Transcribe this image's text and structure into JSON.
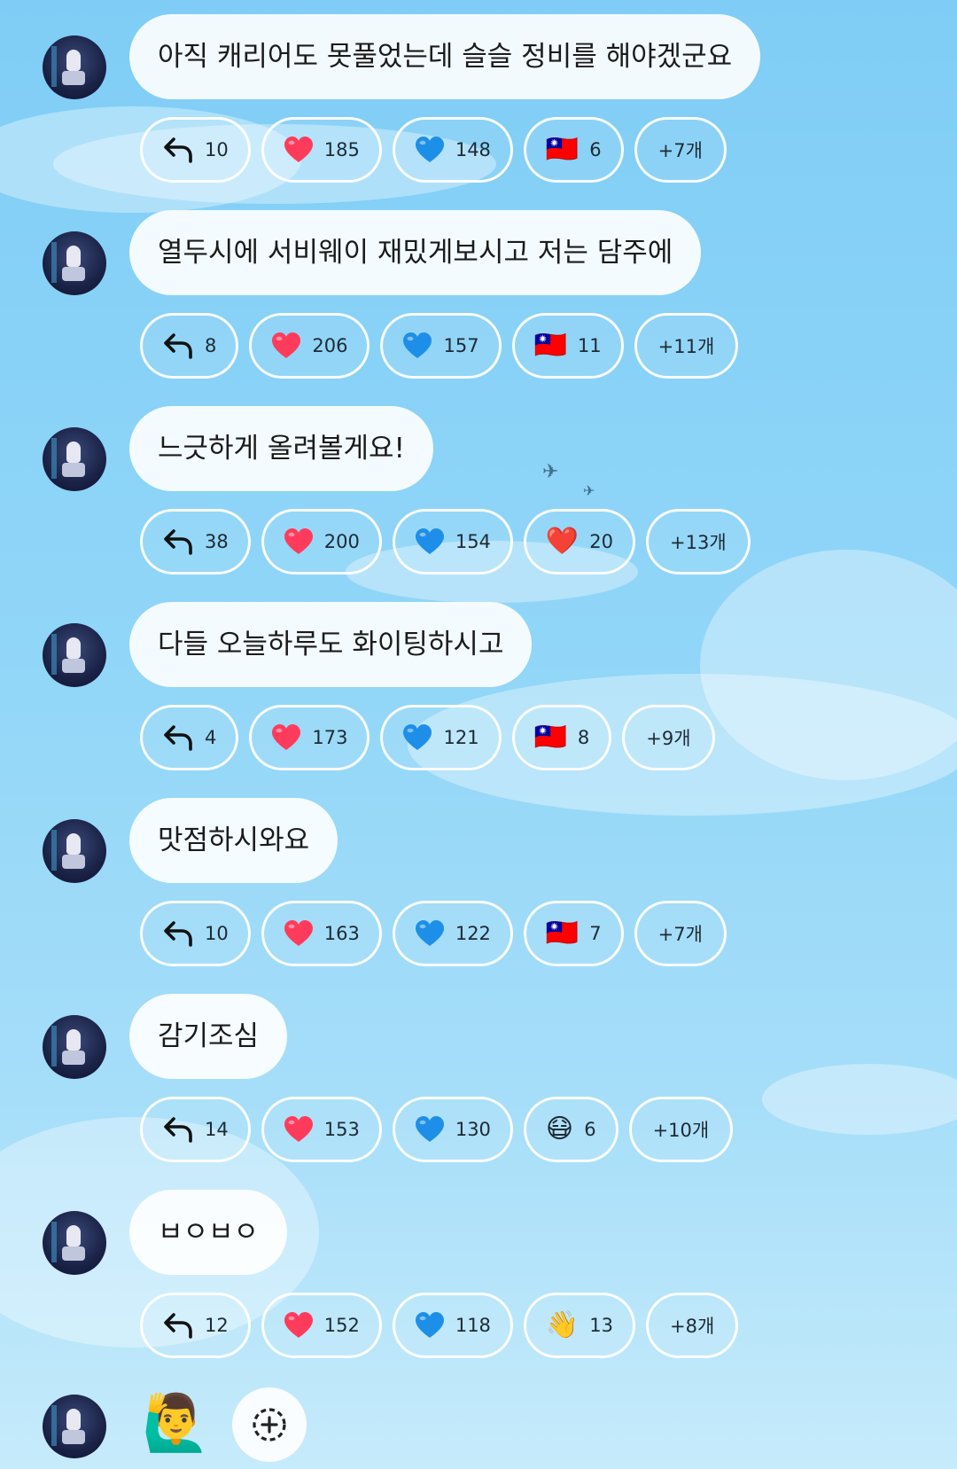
{
  "messages": [
    {
      "text": "아직 캐리어도 못풀었는데 슬슬 정비를 해야겠군요",
      "reply": "10",
      "heart": "185",
      "blue": "148",
      "extra_icon": "taiwan-flag",
      "extra_emoji": "🇹🇼",
      "extra": "6",
      "more": "+7개"
    },
    {
      "text": "열두시에 서비웨이 재밌게보시고 저는 담주에",
      "reply": "8",
      "heart": "206",
      "blue": "157",
      "extra_icon": "taiwan-flag",
      "extra_emoji": "🇹🇼",
      "extra": "11",
      "more": "+11개"
    },
    {
      "text": "느긋하게 올려볼게요!",
      "reply": "38",
      "heart": "200",
      "blue": "154",
      "extra_icon": "red-heart",
      "extra_emoji": "❤️",
      "extra": "20",
      "more": "+13개"
    },
    {
      "text": "다들 오늘하루도 화이팅하시고",
      "reply": "4",
      "heart": "173",
      "blue": "121",
      "extra_icon": "taiwan-flag",
      "extra_emoji": "🇹🇼",
      "extra": "8",
      "more": "+9개"
    },
    {
      "text": "맛점하시와요",
      "reply": "10",
      "heart": "163",
      "blue": "122",
      "extra_icon": "taiwan-flag",
      "extra_emoji": "🇹🇼",
      "extra": "7",
      "more": "+7개"
    },
    {
      "text": "감기조심",
      "reply": "14",
      "heart": "153",
      "blue": "130",
      "extra_icon": "mask-face",
      "extra_emoji": "😷",
      "extra": "6",
      "more": "+10개"
    },
    {
      "text": "ㅂㅇㅂㅇ",
      "reply": "12",
      "heart": "152",
      "blue": "118",
      "extra_icon": "waving-hand",
      "extra_emoji": "👋",
      "extra": "13",
      "more": "+8개"
    }
  ],
  "final": {
    "emoji": "🙋‍♂️",
    "emoji_icon": "person-raising-hand",
    "add_icon": "add-reaction-icon"
  },
  "colors": {
    "heart": "#ff3b5c",
    "blue_heart": "#1e8fe8",
    "bubble": "#ffffff",
    "pill_border": "#ffffff"
  }
}
